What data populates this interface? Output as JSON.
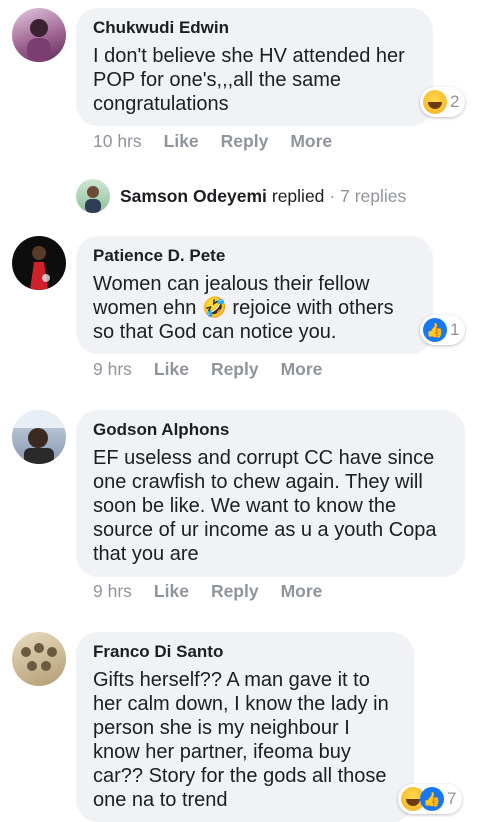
{
  "comments": [
    {
      "author": "Chukwudi Edwin",
      "text": "I don't believe she HV attended her POP for one's,,,all the same congratulations",
      "time": "10 hrs",
      "reaction_count": "2",
      "avatar_color": "#b07aa6"
    },
    {
      "author": "Patience D. Pete",
      "text": "Women can jealous their fellow women ehn 🤣 rejoice with others so that God can notice you.",
      "time": "9 hrs",
      "reaction_count": "1",
      "avatar_color": "#111111"
    },
    {
      "author": "Godson Alphons",
      "text": "EF useless and corrupt CC have since one crawfish to chew again. They will soon be like. We want to know the source of ur income as u a youth Copa that you are",
      "time": "9 hrs"
    },
    {
      "author": "Franco Di Santo",
      "text": "Gifts herself?? A man gave it to her calm down, I know the lady in person she is my neighbour I know her partner, ifeoma buy car?? Story for the gods all those one na to trend",
      "reaction_count": "7"
    }
  ],
  "actions": {
    "like": "Like",
    "reply": "Reply",
    "more": "More"
  },
  "replies_row": {
    "name": "Samson Odeyemi",
    "verb": "replied",
    "count": "· 7 replies"
  },
  "colors": {
    "bubble": "#f0f2f5",
    "meta": "#90949c",
    "like_blue": "#1877f2"
  }
}
